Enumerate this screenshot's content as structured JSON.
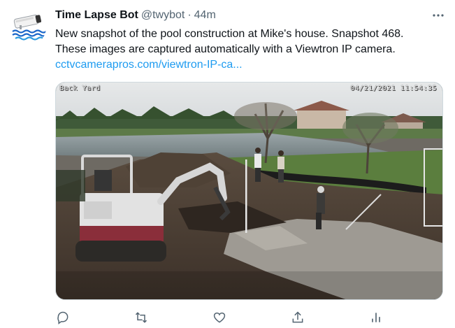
{
  "tweet": {
    "author": {
      "display_name": "Time Lapse Bot",
      "handle": "@twybot",
      "separator": "·",
      "timestamp": "44m",
      "avatar_icon": "security-camera-icon"
    },
    "text_lines": [
      "New snapshot of the pool construction at Mike's house. Snapshot 468.",
      "These images are captured automatically with a Viewtron IP camera."
    ],
    "link_text": "cctvcamerapros.com/viewtron-IP-ca...",
    "media": {
      "overlay_label": "Back Yard",
      "overlay_timestamp": "04/21/2021 11:54:35"
    },
    "actions": [
      "reply-icon",
      "retweet-icon",
      "like-icon",
      "share-icon",
      "analytics-icon"
    ],
    "more_icon": "more-horizontal-icon"
  },
  "colors": {
    "text": "#0f1419",
    "secondary": "#536471",
    "link": "#1d9bf0",
    "border": "#cfd9de"
  }
}
